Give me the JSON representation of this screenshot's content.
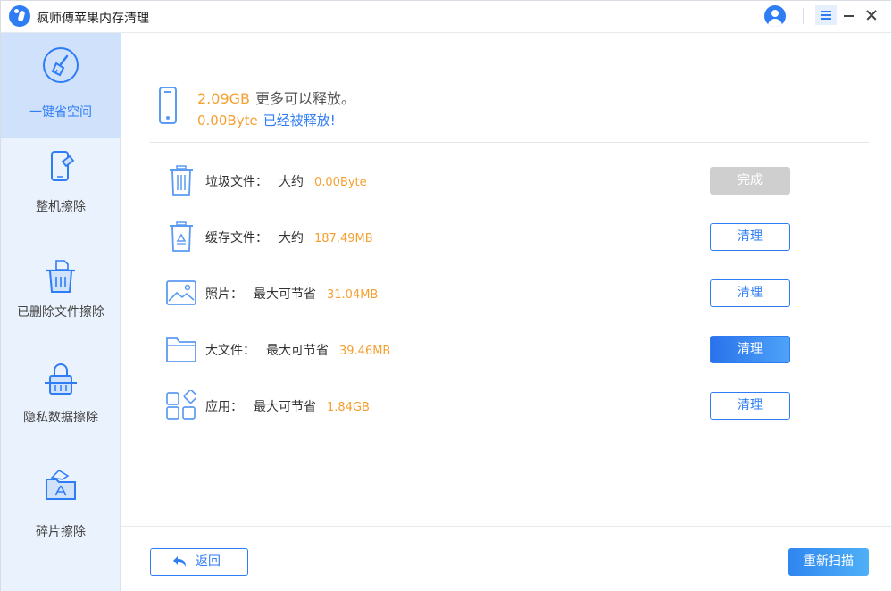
{
  "app": {
    "title": "疯师傅苹果内存清理"
  },
  "sidebar": {
    "items": [
      {
        "label": "一键省空间",
        "icon": "broom-icon",
        "active": true
      },
      {
        "label": "整机擦除",
        "icon": "phone-erase-icon",
        "active": false
      },
      {
        "label": "已删除文件擦除",
        "icon": "trash-file-icon",
        "active": false
      },
      {
        "label": "隐私数据擦除",
        "icon": "privacy-lock-icon",
        "active": false
      },
      {
        "label": "碎片擦除",
        "icon": "fragment-folder-icon",
        "active": false
      }
    ]
  },
  "summary": {
    "releasable_amount": "2.09GB",
    "releasable_text": "更多可以释放。",
    "released_amount": "0.00Byte",
    "released_text": "已经被释放!"
  },
  "rows": [
    {
      "icon": "trash-bin-icon",
      "label": "垃圾文件：",
      "qualifier": "大约",
      "size": "0.00Byte",
      "button": "完成",
      "state": "done"
    },
    {
      "icon": "cache-recycle-icon",
      "label": "缓存文件：",
      "qualifier": "大约",
      "size": "187.49MB",
      "button": "清理",
      "state": "normal"
    },
    {
      "icon": "photo-icon",
      "label": "照片：",
      "qualifier": "最大可节省",
      "size": "31.04MB",
      "button": "清理",
      "state": "normal"
    },
    {
      "icon": "folder-icon",
      "label": "大文件：",
      "qualifier": "最大可节省",
      "size": "39.46MB",
      "button": "清理",
      "state": "primary"
    },
    {
      "icon": "apps-icon",
      "label": "应用：",
      "qualifier": "最大可节省",
      "size": "1.84GB",
      "button": "清理",
      "state": "normal"
    }
  ],
  "footer": {
    "back_label": "返回",
    "rescan_label": "重新扫描"
  },
  "colors": {
    "accent": "#2f7df5",
    "size_highlight": "#f5a030",
    "sidebar_bg": "#eaf2fd",
    "sidebar_active": "#cfe1fb"
  }
}
